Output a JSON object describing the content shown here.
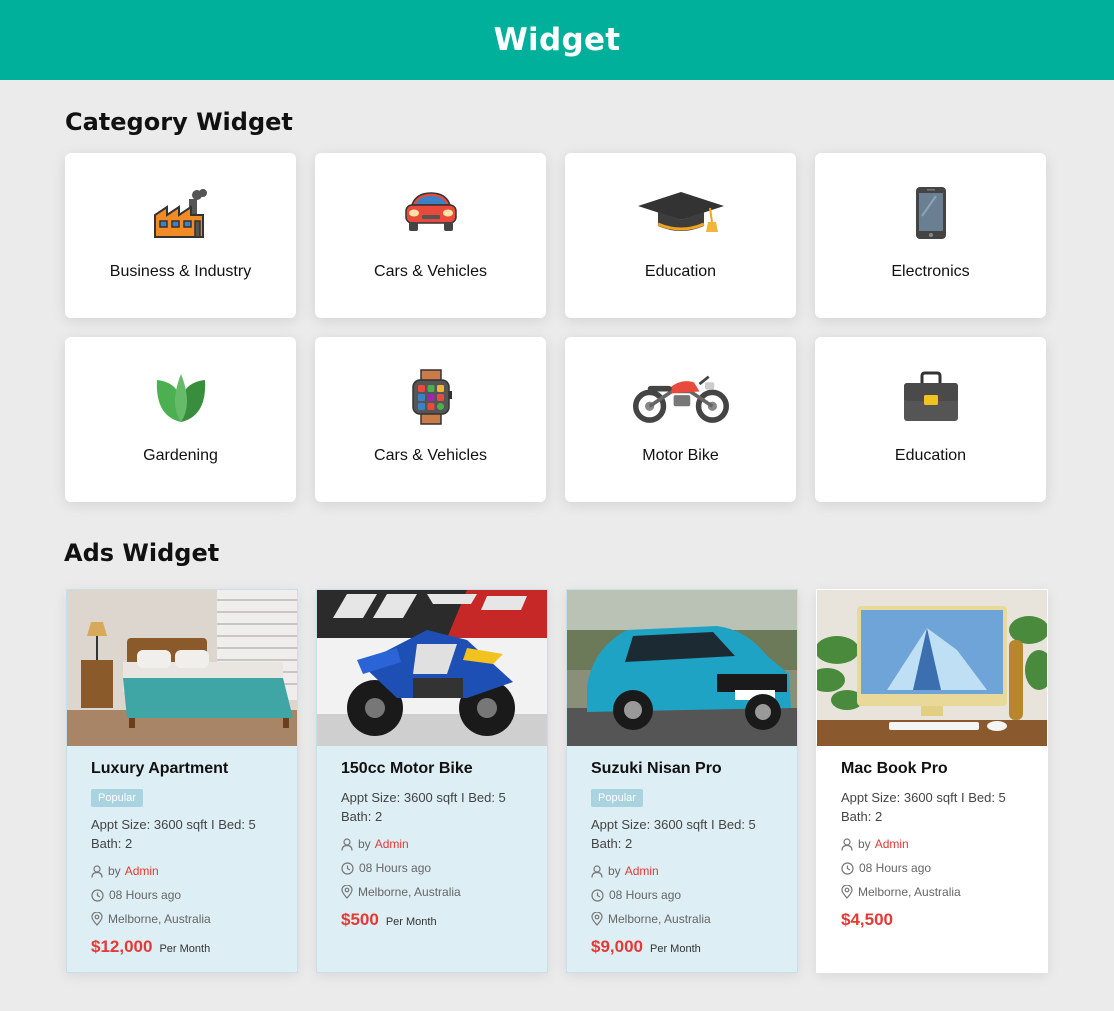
{
  "header": {
    "title": "Widget"
  },
  "category_section": {
    "title": "Category Widget",
    "items": [
      {
        "label": "Business & Industry",
        "icon": "factory-icon"
      },
      {
        "label": "Cars & Vehicles",
        "icon": "car-icon"
      },
      {
        "label": "Education",
        "icon": "graduation-cap-icon"
      },
      {
        "label": "Electronics",
        "icon": "smartphone-icon"
      },
      {
        "label": "Gardening",
        "icon": "leaf-icon"
      },
      {
        "label": "Cars & Vehicles",
        "icon": "smartwatch-icon"
      },
      {
        "label": "Motor Bike",
        "icon": "motorbike-icon"
      },
      {
        "label": "Education",
        "icon": "briefcase-icon"
      }
    ]
  },
  "ads_section": {
    "title": "Ads Widget",
    "items": [
      {
        "title": "Luxury Apartment",
        "badge": "Popular",
        "spec": "Appt Size: 3600 sqft  I  Bed: 5 Bath: 2",
        "by": "by",
        "author": "Admin",
        "time": "08 Hours ago",
        "location": "Melborne, Australia",
        "price": "$12,000",
        "per": "Per Month",
        "image": "bedroom-photo"
      },
      {
        "title": "150cc Motor Bike",
        "badge": "",
        "spec": "Appt Size: 3600 sqft  I  Bed: 5 Bath: 2",
        "by": "by",
        "author": "Admin",
        "time": "08 Hours ago",
        "location": "Melborne, Australia",
        "price": "$500",
        "per": "Per Month",
        "image": "motorbike-photo"
      },
      {
        "title": "Suzuki Nisan Pro",
        "badge": "Popular",
        "spec": "Appt Size: 3600 sqft  I  Bed: 5 Bath: 2",
        "by": "by",
        "author": "Admin",
        "time": "08 Hours ago",
        "location": "Melborne, Australia",
        "price": "$9,000",
        "per": "Per Month",
        "image": "suv-photo"
      },
      {
        "title": "Mac Book Pro",
        "badge": "",
        "spec": "Appt Size: 3600 sqft  I  Bed: 5 Bath: 2",
        "by": "by",
        "author": "Admin",
        "time": "08 Hours ago",
        "location": "Melborne, Australia",
        "price": "$4,500",
        "per": "",
        "image": "imac-desk-photo"
      }
    ]
  },
  "colors": {
    "header": "#00b09b",
    "price": "#e53935",
    "card_tint": "#ddeef4",
    "badge": "#a9d3df"
  }
}
